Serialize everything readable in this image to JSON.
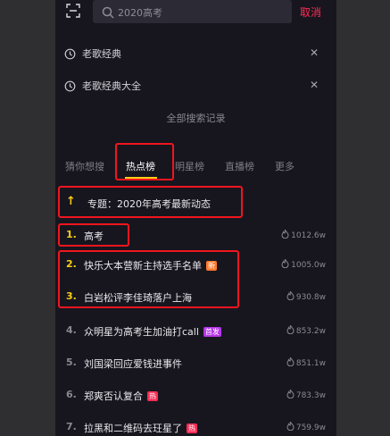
{
  "search": {
    "query": "2020高考",
    "cancel_label": "取消"
  },
  "history": {
    "items": [
      {
        "label": "老歌经典"
      },
      {
        "label": "老歌经典大全"
      }
    ],
    "all_label": "全部搜索记录"
  },
  "tabs": [
    {
      "label": "猜你想搜"
    },
    {
      "label": "热点榜"
    },
    {
      "label": "明星榜"
    },
    {
      "label": "直播榜"
    },
    {
      "label": "更多"
    }
  ],
  "topic": {
    "label": "专题：2020年高考最新动态"
  },
  "ranking": [
    {
      "rank": "1.",
      "title": "高考",
      "badge": "",
      "heat": "1012.6w"
    },
    {
      "rank": "2.",
      "title": "快乐大本营新主持选手名单",
      "badge": "新",
      "heat": "1005.0w"
    },
    {
      "rank": "3.",
      "title": "白岩松评李佳琦落户上海",
      "badge": "",
      "heat": "930.8w"
    },
    {
      "rank": "4.",
      "title": "众明星为高考生加油打call",
      "badge": "首发",
      "heat": "853.2w"
    },
    {
      "rank": "5.",
      "title": "刘国梁回应爱钱进事件",
      "badge": "",
      "heat": "851.1w"
    },
    {
      "rank": "6.",
      "title": "郑爽否认复合",
      "badge": "热",
      "heat": "783.3w"
    },
    {
      "rank": "7.",
      "title": "拉黑和二维码去玨星了",
      "badge": "热",
      "heat": "759.9w"
    }
  ],
  "colors": {
    "accent": "#fe2c55",
    "highlight": "#f2151d",
    "tab_underline": "#face15"
  }
}
